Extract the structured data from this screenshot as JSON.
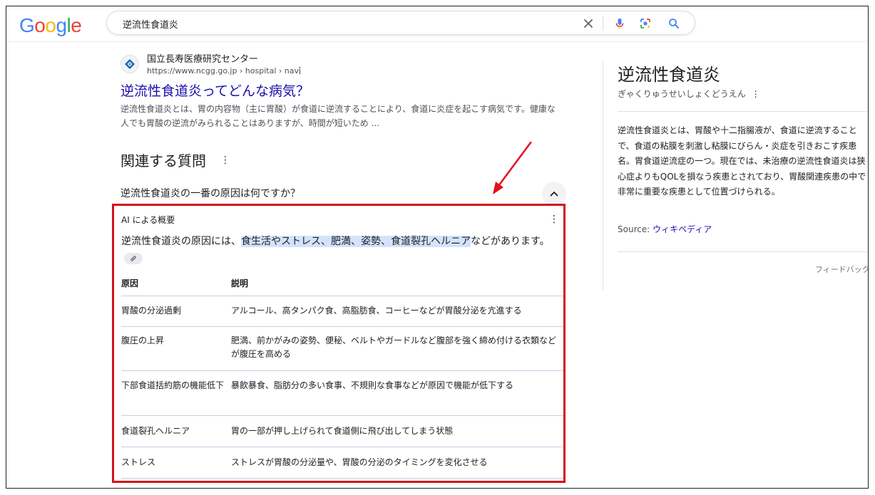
{
  "header": {
    "logo_letters": [
      {
        "char": "G",
        "color": "#4285f4"
      },
      {
        "char": "o",
        "color": "#ea4335"
      },
      {
        "char": "o",
        "color": "#fbbc05"
      },
      {
        "char": "g",
        "color": "#4285f4"
      },
      {
        "char": "l",
        "color": "#34a853"
      },
      {
        "char": "e",
        "color": "#ea4335"
      }
    ],
    "search_query": "逆流性食道炎",
    "icons": [
      "clear-icon",
      "mic-icon",
      "lens-icon",
      "search-icon"
    ]
  },
  "result": {
    "favicon": "site-favicon-icon",
    "site_name": "国立長寿医療研究センター",
    "url": "https://www.ncgg.go.jp › hospital › navi",
    "title": "逆流性食道炎ってどんな病気？",
    "snippet": "逆流性食道炎とは、胃の内容物（主に胃酸）が食道に逆流することにより、食道に炎症を起こす病気です。健康な人でも胃酸の逆流がみられることはありますが、時間が短いため ..."
  },
  "related_questions": {
    "title": "関連する質問",
    "question": "逆流性食道炎の一番の原因は何ですか？"
  },
  "ai_overview": {
    "label": "AI による概要",
    "summary_pre": "逆流性食道炎の原因には、",
    "summary_highlight": "食生活やストレス、肥満、姿勢、食道裂孔ヘルニア",
    "summary_post": "などがあります。",
    "table": {
      "headers": {
        "cause": "原因",
        "description": "説明"
      },
      "rows": [
        {
          "cause": "胃酸の分泌過剰",
          "description": "アルコール、高タンパク食、高脂肪食、コーヒーなどが胃酸分泌を亢進する"
        },
        {
          "cause": "腹圧の上昇",
          "description": "肥満、前かがみの姿勢、便秘、ベルトやガードルなど腹部を強く締め付ける衣類などが腹圧を高める"
        },
        {
          "cause": "下部食道括約筋の機能低下",
          "description": "暴飲暴食、脂肪分の多い食事、不規則な食事などが原因で機能が低下する"
        },
        {
          "cause": "食道裂孔ヘルニア",
          "description": "胃の一部が押し上げられて食道側に飛び出してしまう状態"
        },
        {
          "cause": "ストレス",
          "description": "ストレスが胃酸の分泌量や、胃酸の分泌のタイミングを変化させる"
        }
      ]
    },
    "highlight_border_color": "#d60f18"
  },
  "knowledge_panel": {
    "title": "逆流性食道炎",
    "reading": "ぎゃくりゅうせいしょくどうえん",
    "description": "逆流性食道炎とは、胃酸や十二指腸液が、食道に逆流することで、食道の粘膜を刺激し粘膜にびらん・炎症を引きおこす疾患名。胃食道逆流症の一つ。現在では、未治療の逆流性食道炎は狭心症よりもQOLを損なう疾患とされており、胃酸関連疾患の中で非常に重要な疾患として位置づけられる。",
    "source_label": "Source:",
    "source_link": "ウィキペディア",
    "feedback": "フィードバック"
  }
}
